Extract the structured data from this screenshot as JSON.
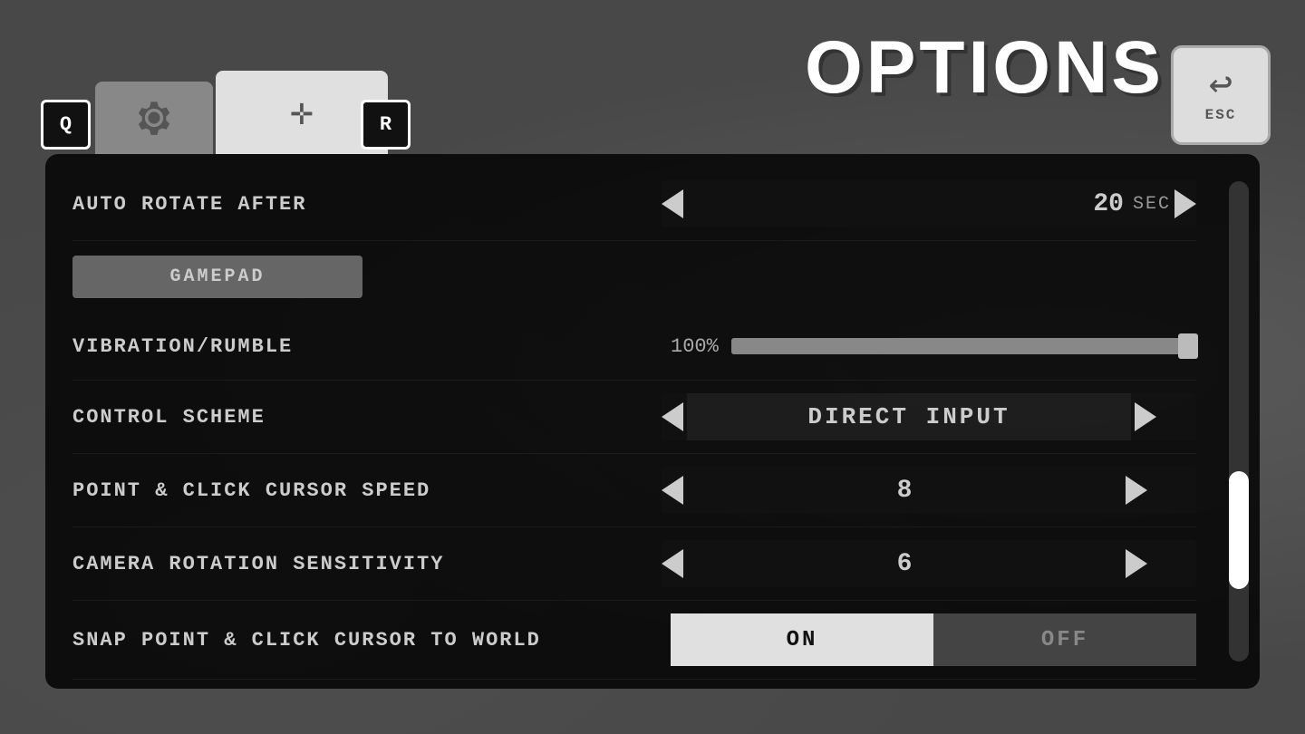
{
  "page": {
    "title": "OPTIONS"
  },
  "tabs": {
    "q_label": "Q",
    "r_label": "R",
    "gear_tab_label": "gear",
    "gamepad_tab_label": "gamepad",
    "esc_label": "ESC"
  },
  "settings": {
    "auto_rotate_after": {
      "label": "AUTO ROTATE AFTER",
      "value": "20",
      "unit": "SEC"
    },
    "section_gamepad": {
      "label": "GAMEPAD"
    },
    "vibration_rumble": {
      "label": "VIBRATION/RUMBLE",
      "value": "100%",
      "slider_percent": 100
    },
    "control_scheme": {
      "label": "CONTROL SCHEME",
      "value": "DIRECT INPUT"
    },
    "point_click_cursor_speed": {
      "label": "POINT & CLICK CURSOR SPEED",
      "value": "8"
    },
    "camera_rotation_sensitivity": {
      "label": "CAMERA ROTATION SENSITIVITY",
      "value": "6"
    },
    "snap_cursor_to_world": {
      "label": "SNAP POINT & CLICK CURSOR TO WORLD",
      "on_label": "ON",
      "off_label": "OFF",
      "selected": "ON"
    }
  },
  "colors": {
    "bg": "#3a3a3a",
    "panel_bg": "rgba(0,0,0,0.82)",
    "accent": "#ffffff",
    "muted": "#888888"
  }
}
